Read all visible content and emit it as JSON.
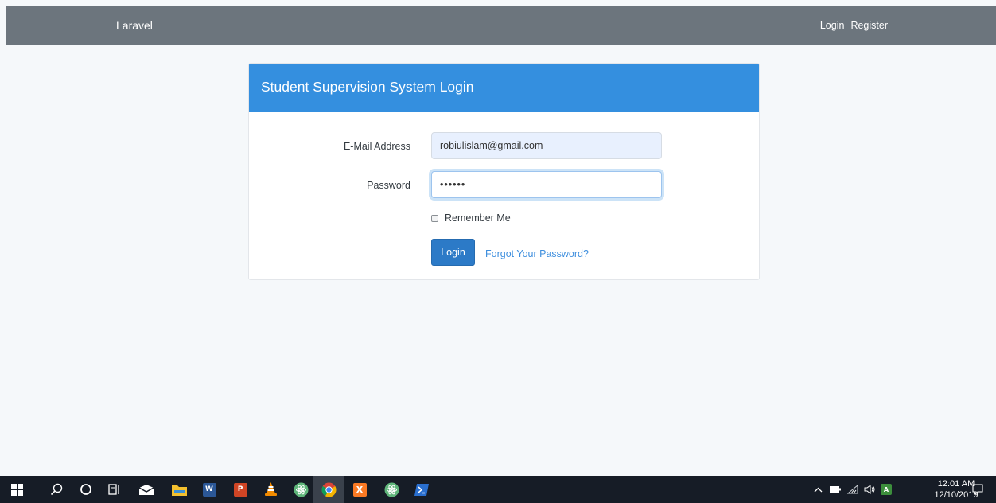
{
  "navbar": {
    "brand": "Laravel",
    "links": [
      "Login",
      "Register"
    ]
  },
  "card": {
    "title": "Student Supervision System Login",
    "email_label": "E-Mail Address",
    "email_value": "robiulislam@gmail.com",
    "password_label": "Password",
    "password_masked": "••••••",
    "remember_label": "Remember Me",
    "remember_checked": false,
    "login_button": "Login",
    "forgot_link": "Forgot Your Password?"
  },
  "taskbar": {
    "apps": [
      "windows-start-icon",
      "search-icon",
      "cortana-icon",
      "task-view-icon",
      "mail-icon",
      "file-explorer-icon",
      "word-icon",
      "powerpoint-icon",
      "vlc-icon",
      "atom-icon",
      "chrome-icon",
      "xampp-icon",
      "atom-icon",
      "powershell-icon"
    ],
    "active_app": "chrome-icon",
    "clock_time": "12:01 AM",
    "clock_date": "12/10/2019"
  },
  "colors": {
    "navbar": "#6c757d",
    "card_header": "#348fdf",
    "primary_button": "#2c7ac7",
    "link": "#3f8fde",
    "page_background": "#f5f8fa",
    "taskbar": "#161c26"
  }
}
